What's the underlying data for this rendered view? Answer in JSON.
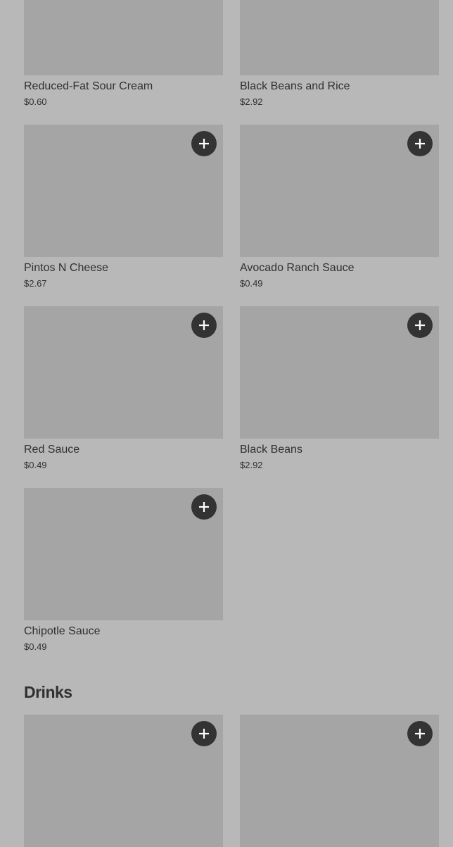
{
  "sides": {
    "items": [
      {
        "name": "Reduced-Fat Sour Cream",
        "price": "$0.60"
      },
      {
        "name": "Black Beans and Rice",
        "price": "$2.92"
      },
      {
        "name": "Pintos N Cheese",
        "price": "$2.67"
      },
      {
        "name": "Avocado Ranch Sauce",
        "price": "$0.49"
      },
      {
        "name": "Red Sauce",
        "price": "$0.49"
      },
      {
        "name": "Black Beans",
        "price": "$2.92"
      },
      {
        "name": "Chipotle Sauce",
        "price": "$0.49"
      }
    ]
  },
  "drinks": {
    "title": "Drinks"
  },
  "colors": {
    "background": "#b8b8b8",
    "image_placeholder": "#a5a5a5",
    "add_button": "#333333",
    "text": "#303030"
  },
  "icons": {
    "add": "plus-icon"
  }
}
